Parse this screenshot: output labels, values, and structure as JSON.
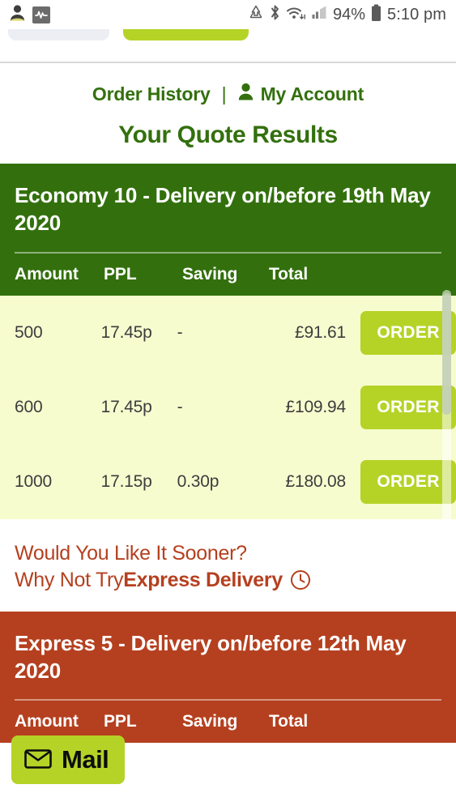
{
  "status_bar": {
    "left_icons": [
      {
        "name": "contact-icon",
        "label": "contact"
      },
      {
        "name": "activity-monitor-icon",
        "label": "activity"
      }
    ],
    "right_icons": [
      {
        "name": "data-saver-icon",
        "label": "data saver"
      },
      {
        "name": "bluetooth-icon",
        "label": "bluetooth"
      },
      {
        "name": "wifi-icon",
        "label": "wifi"
      },
      {
        "name": "cellular-signal-icon",
        "label": "signal"
      }
    ],
    "battery_percent": "94%",
    "time": "5:10 pm"
  },
  "nav": {
    "order_history": "Order History",
    "separator": "|",
    "my_account": "My Account",
    "account_icon": "person-icon"
  },
  "page_title": "Your Quote Results",
  "quotes": [
    {
      "id": "economy-10",
      "title": "Economy 10 - Delivery on/before 19th May 2020",
      "theme": "green",
      "columns": [
        "Amount",
        "PPL",
        "Saving",
        "Total"
      ],
      "order_label": "ORDER",
      "rows": [
        {
          "amount": "500",
          "ppl": "17.45p",
          "saving": "-",
          "total": "£91.61"
        },
        {
          "amount": "600",
          "ppl": "17.45p",
          "saving": "-",
          "total": "£109.94"
        },
        {
          "amount": "1000",
          "ppl": "17.15p",
          "saving": "0.30p",
          "total": "£180.08"
        }
      ]
    },
    {
      "id": "express-5",
      "title": "Express 5 - Delivery on/before 12th May 2020",
      "theme": "rust",
      "columns": [
        "Amount",
        "PPL",
        "Saving",
        "Total"
      ],
      "order_label": "ORDER",
      "rows": []
    }
  ],
  "promo": {
    "line1": "Would You Like It Sooner?",
    "line2_prefix": "Why Not Try ",
    "line2_strong": "Express Delivery",
    "clock_icon": "clock-icon"
  },
  "mail_button": {
    "label": "Mail",
    "icon": "mail-envelope-icon"
  },
  "colors": {
    "green": "#33700d",
    "lime": "#b5d327",
    "cream": "#f7fccf",
    "rust": "#b5401f",
    "row_text": "#3d3d3d"
  }
}
